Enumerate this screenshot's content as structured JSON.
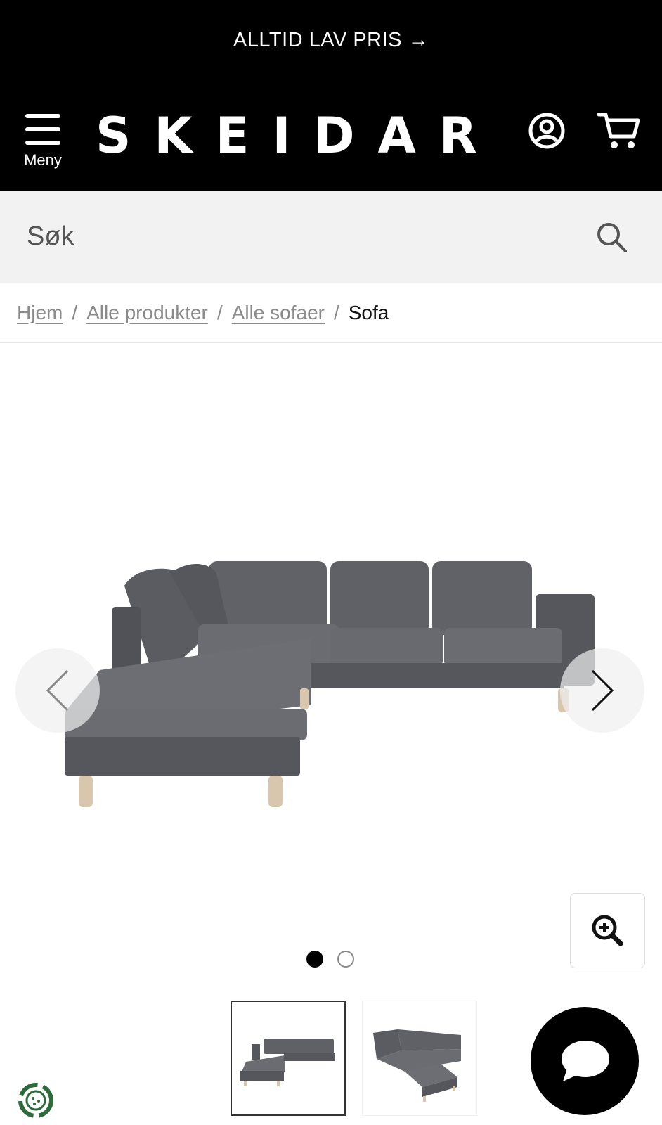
{
  "promo": {
    "text": "ALLTID LAV PRIS →"
  },
  "header": {
    "menu_label": "Meny",
    "logo_text": "SKEIDAR",
    "icons": {
      "menu": "hamburger-icon",
      "account": "user-circle-icon",
      "cart": "shopping-cart-icon"
    }
  },
  "search": {
    "placeholder": "Søk",
    "value": "",
    "icon": "search-icon"
  },
  "breadcrumb": {
    "items": [
      {
        "label": "Hjem",
        "link": true
      },
      {
        "label": "Alle produkter",
        "link": true
      },
      {
        "label": "Alle sofaer",
        "link": true
      },
      {
        "label": "Sofa",
        "link": false
      }
    ],
    "separator": "/"
  },
  "gallery": {
    "image": "corner-sofa-grey",
    "current_slide": 1,
    "total_slides": 2,
    "icons": {
      "prev": "chevron-left-icon",
      "next": "chevron-right-icon",
      "zoom": "zoom-in-icon"
    }
  },
  "thumbnails": [
    {
      "image": "corner-sofa-front",
      "selected": true
    },
    {
      "image": "corner-sofa-angled",
      "selected": false
    }
  ],
  "widgets": {
    "chat_icon": "chat-bubble-icon",
    "eco_icon": "recycle-badge-icon"
  },
  "colors": {
    "header_bg": "#000000",
    "search_bg": "#f2f2f2",
    "sofa_fabric": "#5f6166",
    "legs": "#d8c7ad"
  }
}
